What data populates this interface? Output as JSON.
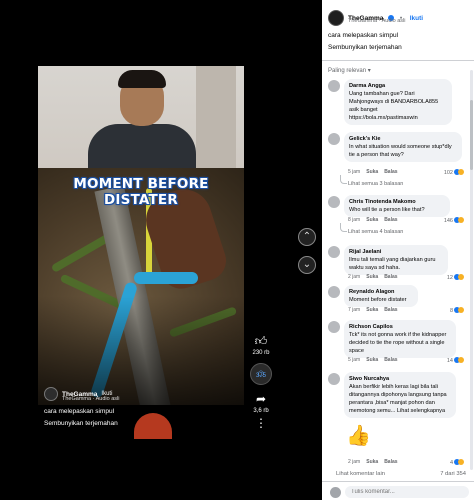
{
  "video": {
    "overlay_title": "MOMENT BEFORE DISTATER",
    "author": "TheGamma",
    "follow": "Ikuti",
    "sub": "TheGamma · Audio asli",
    "caption": "cara melepaskan simpul",
    "translate": "Sembunyikan terjemahan",
    "likes": "230 rb",
    "comments": "375",
    "shares": "3,6 rb"
  },
  "panel": {
    "author": "TheGamma",
    "follow": "Ikuti",
    "sub": "TheGamma · Audio asli",
    "caption": "cara melepaskan simpul",
    "translate": "Sembunyikan terjemahan",
    "sort": "Paling relevan",
    "comments": [
      {
        "author": "Darma Angga",
        "text": "Uang tambahan gue? Dari Mahjongways di BANDARBOLA855 asik banget https://bola.mx/pastimaswin"
      },
      {
        "author": "Gelick's Kie",
        "text": "In what situation would someone stup*dly tie a person that way?",
        "time": "5 jam",
        "like": "Suka",
        "reply": "Balas",
        "reactions": "102",
        "more": "Lihat semua 3 balasan"
      },
      {
        "author": "Chris Tinotenda Makomo",
        "text": "Who will tie a person like that?",
        "time": "8 jam",
        "like": "Suka",
        "reply": "Balas",
        "reactions": "146",
        "more": "Lihat semua 4 balasan"
      },
      {
        "author": "Rijal Jaelani",
        "text": "Ilmu tali temali yang diajarkan guru waktu saya sd haha.",
        "time": "2 jam",
        "like": "Suka",
        "reply": "Balas",
        "reactions": "12"
      },
      {
        "author": "Reynaldo Alagon",
        "text": "Moment before distater",
        "time": "7 jam",
        "like": "Suka",
        "reply": "Balas",
        "reactions": "8"
      },
      {
        "author": "Richson Capilos",
        "text": "Tck* its not gonna work if the kidnapper decided to tie the rope without a single space",
        "time": "5 jam",
        "like": "Suka",
        "reply": "Balas",
        "reactions": "14"
      },
      {
        "author": "Siwo Nurcahya",
        "text": "Akan berfikir lebih keras lagi bila tali ditangannya dipohonya langsung tanpa perantara ,bisa* manjat pohon dan memotong semu... Lihat selengkapnya",
        "time": "2 jam",
        "like": "Suka",
        "reply": "Balas",
        "reactions": "4"
      }
    ],
    "more_comments": "Lihat komentar lain",
    "count": "7 dari 354",
    "input_placeholder": "Tulis komentar..."
  }
}
